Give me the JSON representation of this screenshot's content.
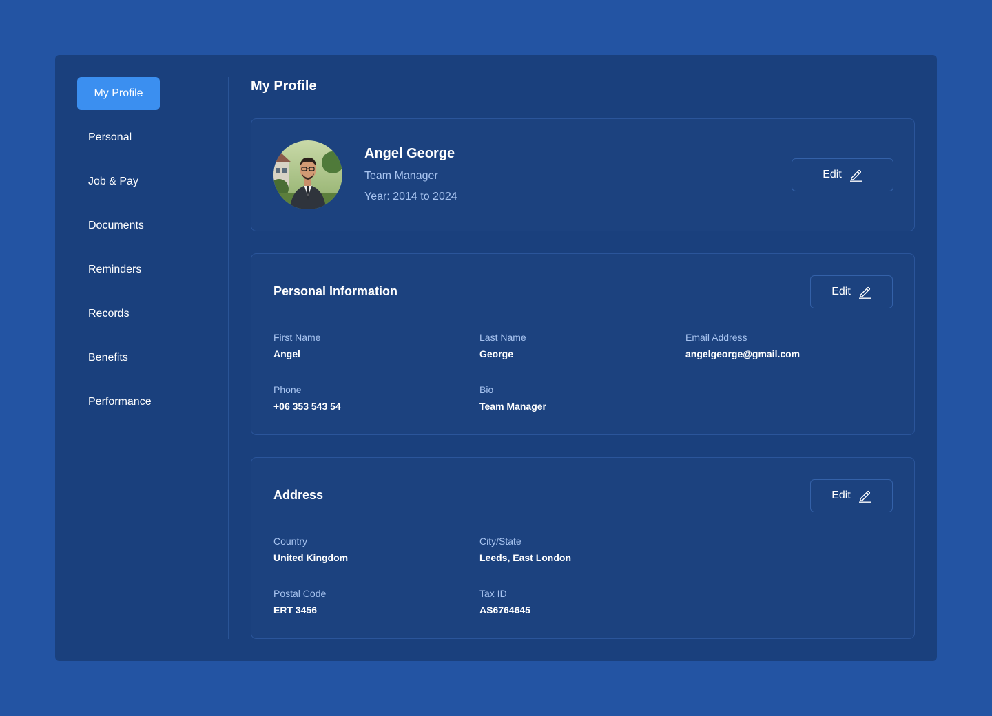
{
  "sidebar": {
    "items": [
      {
        "label": "My Profile"
      },
      {
        "label": "Personal"
      },
      {
        "label": "Job & Pay"
      },
      {
        "label": "Documents"
      },
      {
        "label": "Reminders"
      },
      {
        "label": "Records"
      },
      {
        "label": "Benefits"
      },
      {
        "label": "Performance"
      }
    ],
    "active": "My Profile"
  },
  "page": {
    "title": "My Profile"
  },
  "profile": {
    "name": "Angel George",
    "role": "Team Manager",
    "years": "Year: 2014 to 2024",
    "edit_label": "Edit"
  },
  "personal": {
    "title": "Personal Information",
    "edit_label": "Edit",
    "fields": [
      {
        "label": "First Name",
        "value": "Angel"
      },
      {
        "label": "Last Name",
        "value": "George"
      },
      {
        "label": "Email Address",
        "value": "angelgeorge@gmail.com"
      },
      {
        "label": "Phone",
        "value": "+06 353 543 54"
      },
      {
        "label": "Bio",
        "value": "Team Manager"
      }
    ]
  },
  "address": {
    "title": "Address",
    "edit_label": "Edit",
    "fields": [
      {
        "label": "Country",
        "value": "United Kingdom"
      },
      {
        "label": "City/State",
        "value": "Leeds, East London"
      },
      {
        "label": "Postal Code",
        "value": "ERT 3456"
      },
      {
        "label": "Tax ID",
        "value": "AS6764645"
      }
    ]
  },
  "icons": {
    "edit": "pencil-edit-icon",
    "avatar": "profile-photo"
  },
  "colors": {
    "background": "#2354a3",
    "panel": "#1a407d",
    "card": "#1c427f",
    "accent": "#3b8ff0",
    "muted_text": "#a8c4f0"
  }
}
